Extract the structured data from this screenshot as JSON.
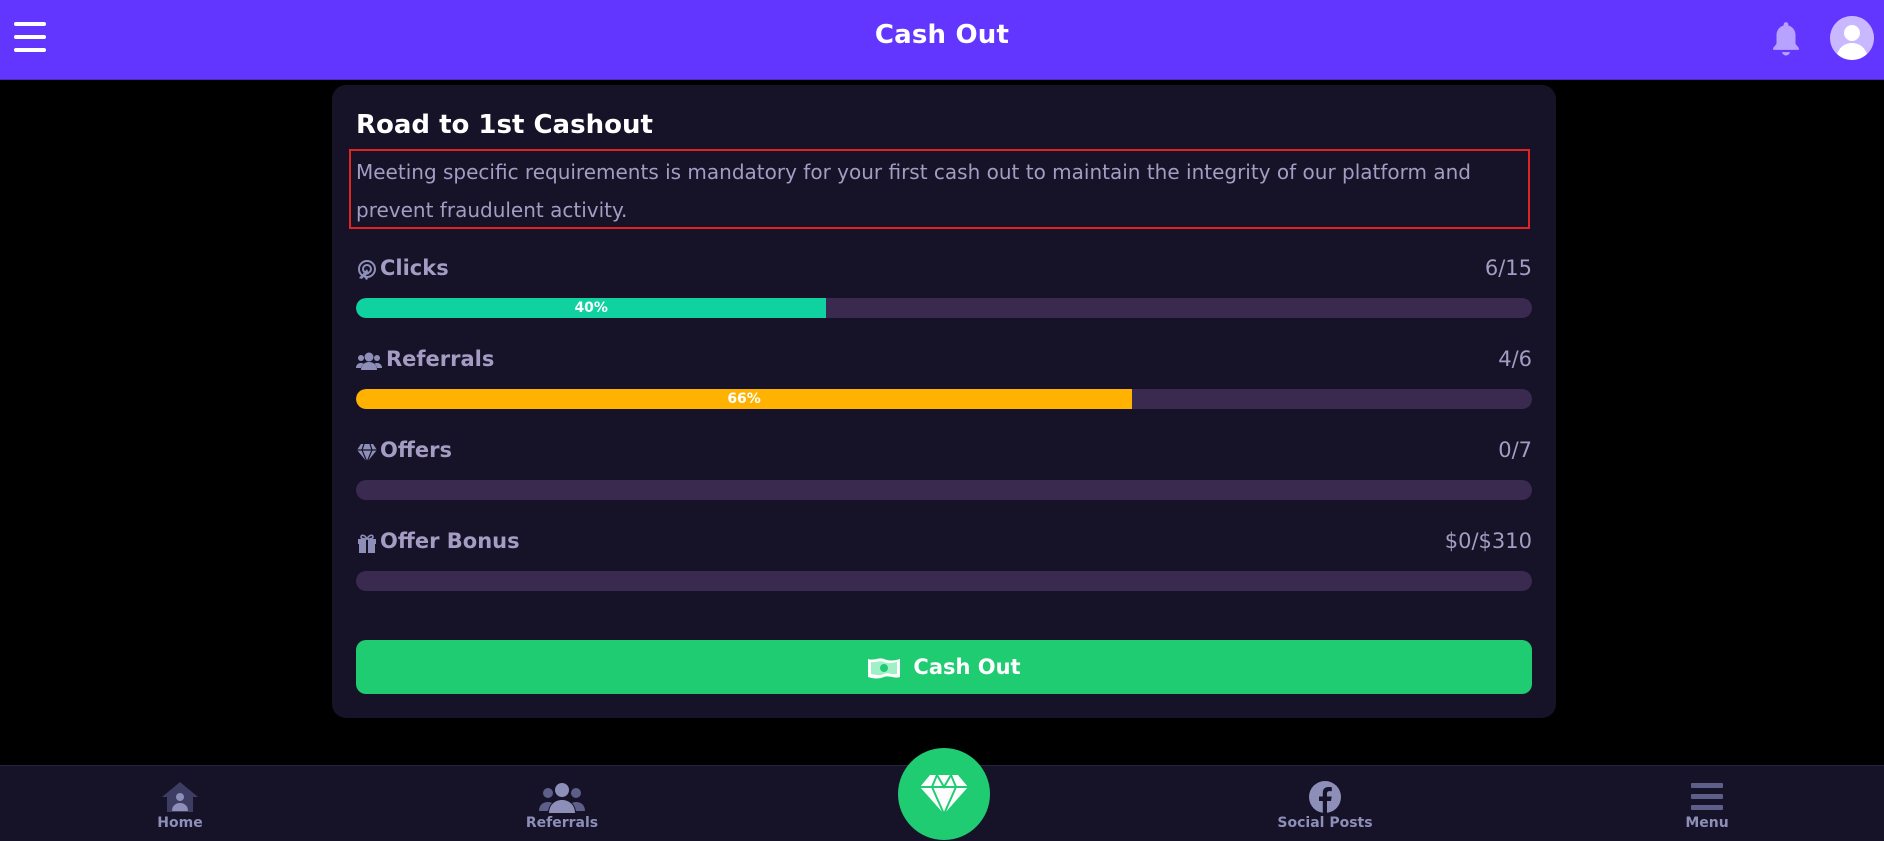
{
  "header": {
    "title": "Cash Out",
    "menu_icon": "hamburger-menu-icon",
    "bell_icon": "bell-icon",
    "avatar_icon": "user-avatar-icon",
    "color": "#6236ff"
  },
  "card": {
    "title": "Road to 1st Cashout",
    "description": "Meeting specific requirements is mandatory for your first cash out to maintain the integrity of our platform and prevent fraudulent activity.",
    "requirements": [
      {
        "label": "Clicks",
        "icon": "click-icon",
        "count": "6/15",
        "percent_label": "40%",
        "progress": 0.4,
        "color": "#0fd2a0"
      },
      {
        "label": "Referrals",
        "icon": "users-icon",
        "count": "4/6",
        "percent_label": "66%",
        "progress": 0.66,
        "color": "#ffb200"
      },
      {
        "label": "Offers",
        "icon": "diamond-icon",
        "count": "0/7",
        "percent_label": "",
        "progress": 0,
        "color": "#0fd2a0"
      },
      {
        "label": "Offer Bonus",
        "icon": "gift-icon",
        "count": "$0/$310",
        "percent_label": "",
        "progress": 0,
        "color": "#0fd2a0"
      }
    ],
    "cashout_button": {
      "label": "Cash Out",
      "icon": "money-icon",
      "color": "#1fcc72"
    }
  },
  "bottom_nav": {
    "items": [
      {
        "label": "Home",
        "icon": "home-icon"
      },
      {
        "label": "Referrals",
        "icon": "referrals-icon"
      },
      {
        "label": "Social Posts",
        "icon": "facebook-icon"
      },
      {
        "label": "Menu",
        "icon": "menu-icon"
      }
    ],
    "center_icon": "diamond-icon"
  }
}
